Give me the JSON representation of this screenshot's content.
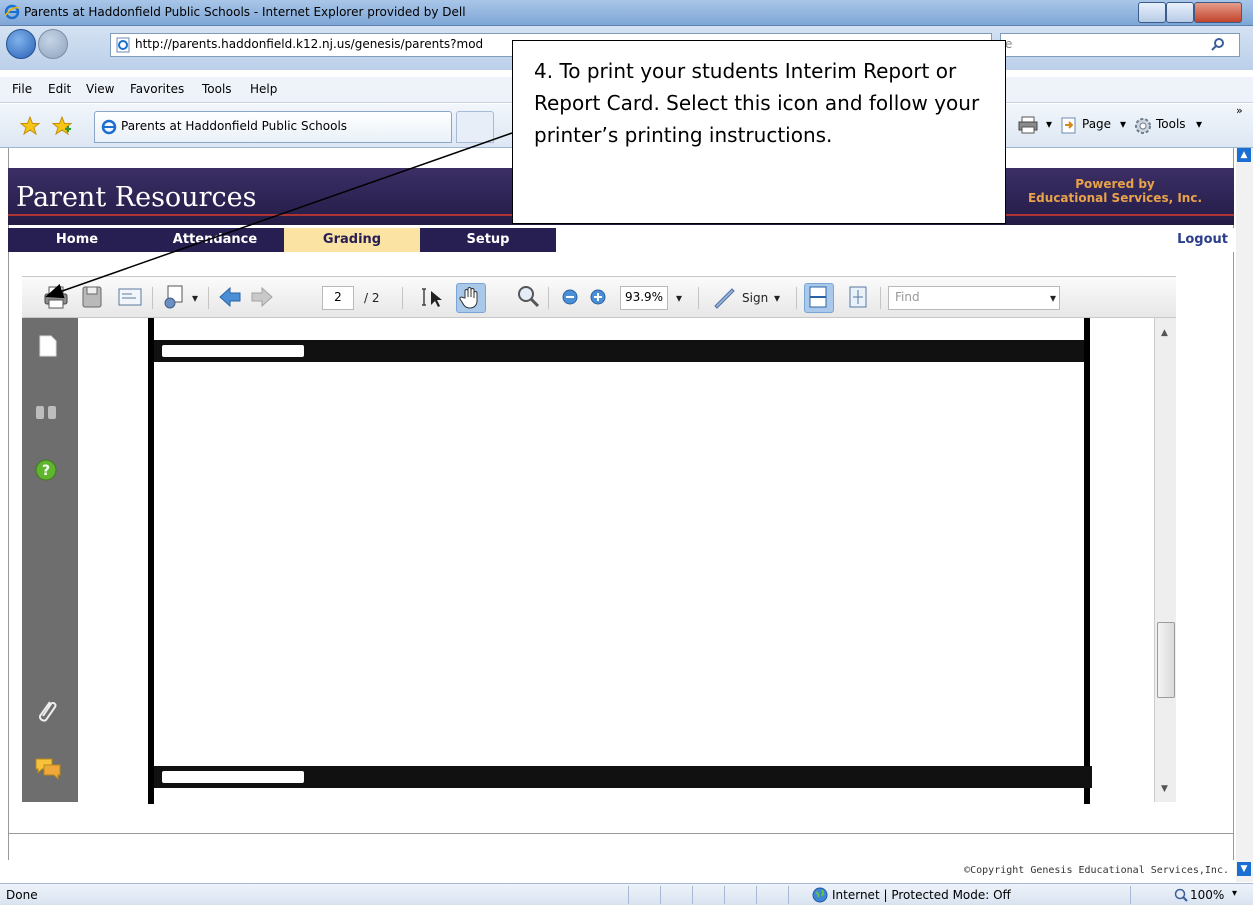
{
  "window": {
    "title": "Parents at Haddonfield Public Schools - Internet Explorer provided by Dell"
  },
  "addressbar": {
    "url": "http://parents.haddonfield.k12.nj.us/genesis/parents?mod",
    "search_fragment": "e"
  },
  "menubar": {
    "items": [
      "File",
      "Edit",
      "View",
      "Favorites",
      "Tools",
      "Help"
    ]
  },
  "tabs": {
    "active_tab": "Parents at Haddonfield Public Schools",
    "commands": {
      "page": "Page",
      "tools": "Tools"
    }
  },
  "site": {
    "logo": "Parent Resources",
    "powered_line1": "Powered by",
    "powered_line2": "Educational Services, Inc.",
    "nav": [
      "Home",
      "Attendance",
      "Grading",
      "Setup"
    ],
    "active_nav": "Grading",
    "logout": "Logout",
    "copyright": "©Copyright Genesis Educational Services,Inc."
  },
  "pdf": {
    "page_current": "2",
    "page_total": "/ 2",
    "zoom": "93.9%",
    "sign_label": "Sign",
    "find_placeholder": "Find"
  },
  "callout": {
    "text": "4. To print your students Interim Report or Report Card. Select this icon and follow your printer’s printing instructions."
  },
  "statusbar": {
    "status": "Done",
    "zone": "Internet | Protected Mode: Off",
    "zoom": "100%"
  }
}
